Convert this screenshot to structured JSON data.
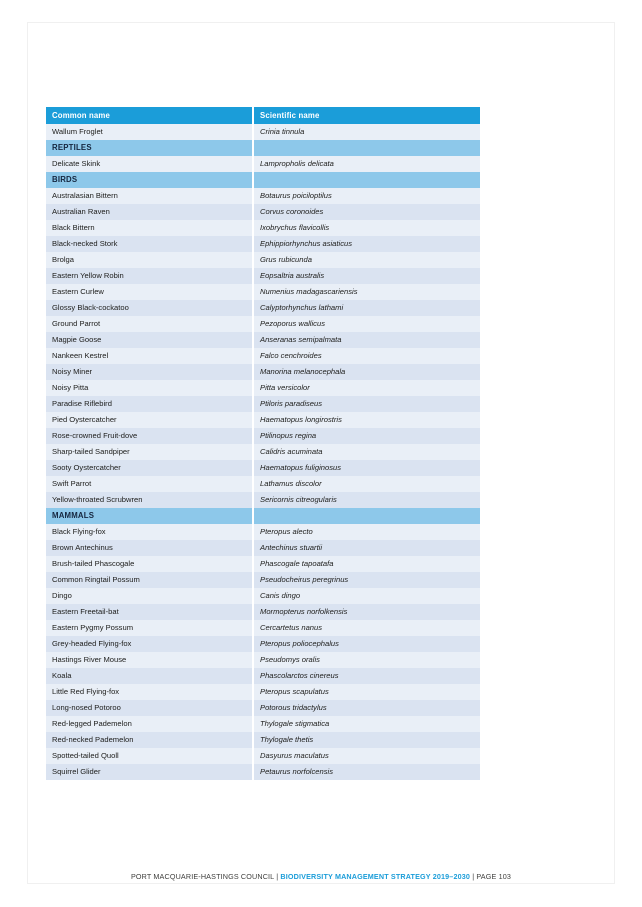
{
  "document": {
    "page_number": "103"
  },
  "table": {
    "columns": [
      {
        "key": "common",
        "label": "Common name"
      },
      {
        "key": "scientific",
        "label": "Scientific name"
      }
    ],
    "rows": [
      {
        "type": "data",
        "common": "Wallum Froglet",
        "scientific": "Crinia tinnula"
      },
      {
        "type": "section",
        "common": "REPTILES",
        "scientific": ""
      },
      {
        "type": "data",
        "common": "Delicate Skink",
        "scientific": "Lampropholis delicata"
      },
      {
        "type": "section",
        "common": "BIRDS",
        "scientific": ""
      },
      {
        "type": "data",
        "common": "Australasian Bittern",
        "scientific": "Botaurus poiciloptilus"
      },
      {
        "type": "data",
        "common": "Australian Raven",
        "scientific": "Corvus coronoides"
      },
      {
        "type": "data",
        "common": "Black Bittern",
        "scientific": "Ixobrychus flavicollis"
      },
      {
        "type": "data",
        "common": "Black-necked Stork",
        "scientific": "Ephippiorhynchus asiaticus"
      },
      {
        "type": "data",
        "common": "Brolga",
        "scientific": "Grus rubicunda"
      },
      {
        "type": "data",
        "common": "Eastern Yellow Robin",
        "scientific": "Eopsaltria australis"
      },
      {
        "type": "data",
        "common": "Eastern Curlew",
        "scientific": "Numenius madagascariensis"
      },
      {
        "type": "data",
        "common": "Glossy Black-cockatoo",
        "scientific": "Calyptorhynchus lathami"
      },
      {
        "type": "data",
        "common": "Ground Parrot",
        "scientific": "Pezoporus wallicus"
      },
      {
        "type": "data",
        "common": "Magpie Goose",
        "scientific": "Anseranas semipalmata"
      },
      {
        "type": "data",
        "common": "Nankeen Kestrel",
        "scientific": "Falco cenchroides"
      },
      {
        "type": "data",
        "common": "Noisy Miner",
        "scientific": "Manorina melanocephala"
      },
      {
        "type": "data",
        "common": "Noisy Pitta",
        "scientific": "Pitta versicolor"
      },
      {
        "type": "data",
        "common": "Paradise Riflebird",
        "scientific": "Ptiloris paradiseus"
      },
      {
        "type": "data",
        "common": "Pied Oystercatcher",
        "scientific": "Haematopus longirostris"
      },
      {
        "type": "data",
        "common": "Rose-crowned Fruit-dove",
        "scientific": "Ptilinopus regina"
      },
      {
        "type": "data",
        "common": "Sharp-tailed Sandpiper",
        "scientific": "Calidris acuminata"
      },
      {
        "type": "data",
        "common": "Sooty Oystercatcher",
        "scientific": "Haematopus fuliginosus"
      },
      {
        "type": "data",
        "common": "Swift Parrot",
        "scientific": "Lathamus discolor"
      },
      {
        "type": "data",
        "common": "Yellow-throated Scrubwren",
        "scientific": "Sericornis citreogularis"
      },
      {
        "type": "section",
        "common": "MAMMALS",
        "scientific": ""
      },
      {
        "type": "data",
        "common": "Black Flying-fox",
        "scientific": "Pteropus alecto"
      },
      {
        "type": "data",
        "common": "Brown Antechinus",
        "scientific": "Antechinus stuartii"
      },
      {
        "type": "data",
        "common": "Brush-tailed Phascogale",
        "scientific": "Phascogale tapoatafa"
      },
      {
        "type": "data",
        "common": "Common Ringtail Possum",
        "scientific": "Pseudocheirus peregrinus"
      },
      {
        "type": "data",
        "common": "Dingo",
        "scientific": "Canis dingo"
      },
      {
        "type": "data",
        "common": "Eastern Freetail-bat",
        "scientific": "Mormopterus norfolkensis"
      },
      {
        "type": "data",
        "common": "Eastern Pygmy Possum",
        "scientific": "Cercartetus nanus"
      },
      {
        "type": "data",
        "common": "Grey-headed Flying-fox",
        "scientific": "Pteropus poliocephalus"
      },
      {
        "type": "data",
        "common": "Hastings River Mouse",
        "scientific": "Pseudomys oralis"
      },
      {
        "type": "data",
        "common": "Koala",
        "scientific": "Phascolarctos cinereus"
      },
      {
        "type": "data",
        "common": "Little Red Flying-fox",
        "scientific": "Pteropus scapulatus"
      },
      {
        "type": "data",
        "common": "Long-nosed Potoroo",
        "scientific": "Potorous tridactylus"
      },
      {
        "type": "data",
        "common": "Red-legged Pademelon",
        "scientific": "Thylogale stigmatica"
      },
      {
        "type": "data",
        "common": "Red-necked Pademelon",
        "scientific": "Thylogale thetis"
      },
      {
        "type": "data",
        "common": "Spotted-tailed Quoll",
        "scientific": "Dasyurus maculatus"
      },
      {
        "type": "data",
        "common": "Squirrel Glider",
        "scientific": "Petaurus norfolcensis"
      }
    ]
  },
  "footer": {
    "organisation": "PORT MACQUARIE-HASTINGS COUNCIL",
    "separator_left": "|",
    "strategy": "BIODIVERSITY MANAGEMENT STRATEGY 2019–2030",
    "separator_right": "|",
    "page_label": "PAGE 103"
  },
  "colors": {
    "header_blue": "#1b9dd9",
    "section_blue": "#8dc8ea",
    "row_light": "#e9eff7",
    "row_dark": "#dae3f1",
    "section_text": "#15263f",
    "body_text": "#1d1d1b",
    "footer_accent": "#1b9dd9"
  }
}
